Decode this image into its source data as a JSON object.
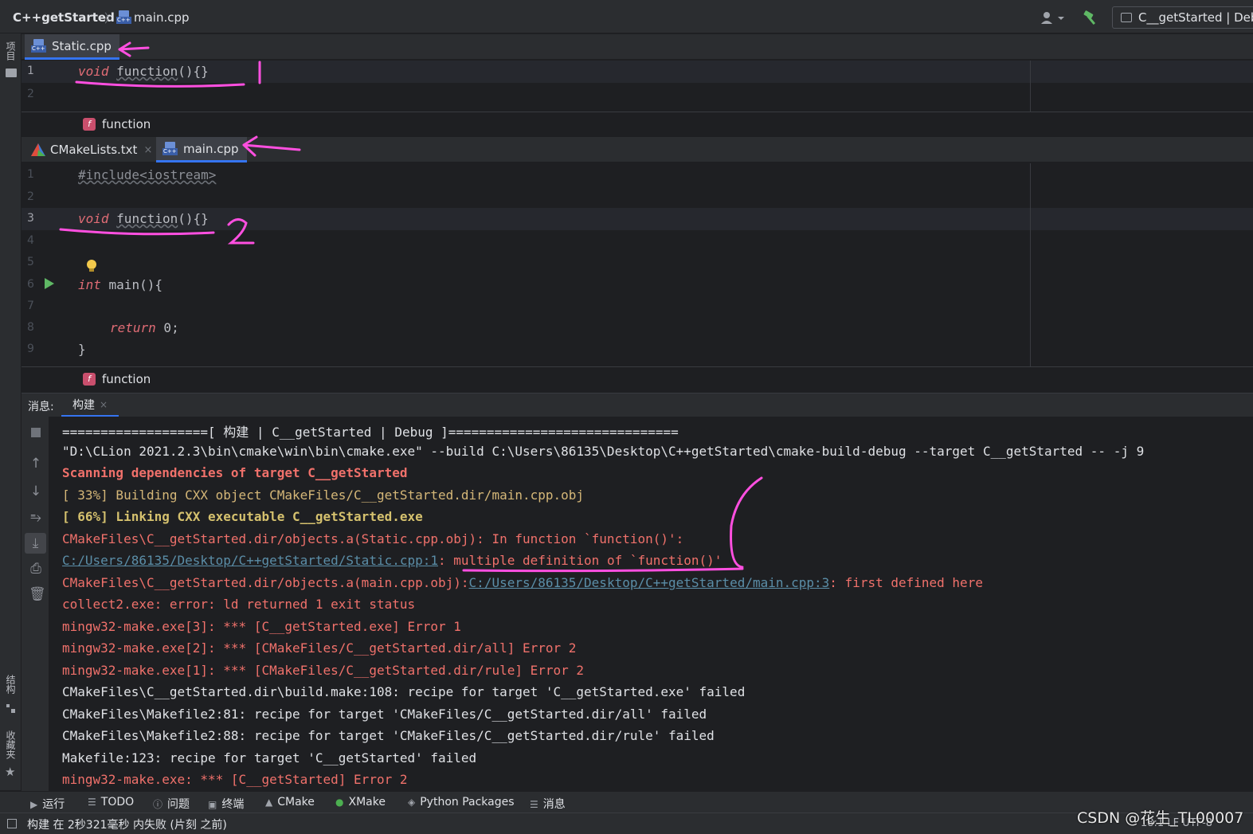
{
  "navbar": {
    "project": "C++getStarted",
    "separator": "〉",
    "file": "main.cpp",
    "run_config": "C__getStarted | Deb"
  },
  "left_strip": {
    "project_label": "项目",
    "structure_label": "结构",
    "favorites_label": "收藏夹"
  },
  "editor_top": {
    "tab": "Static.cpp",
    "lines": [
      "1",
      "2"
    ],
    "code": {
      "kw": "void",
      "fn": "function",
      "rest": "(){}"
    },
    "breadcrumb": "function",
    "annotation_mark": "1"
  },
  "editor_main": {
    "tabs": [
      {
        "label": "CMakeLists.txt",
        "close": "×"
      },
      {
        "label": "main.cpp"
      }
    ],
    "lines": [
      "1",
      "2",
      "3",
      "4",
      "5",
      "6",
      "7",
      "8",
      "9"
    ],
    "code": {
      "include": "#include<iostream>",
      "void_kw": "void",
      "fn_name": "function",
      "fn_rest": "(){}",
      "int_kw": "int",
      "main_decl": " main(){",
      "return_kw": "return",
      "return_rest": " 0;",
      "close": "}"
    },
    "breadcrumb": "function",
    "annotation_mark": "2"
  },
  "messages": {
    "label": "消息:",
    "tab": "构建",
    "tab_close": "×",
    "output": [
      {
        "text": "===================[ 构建 | C__getStarted | Debug ]==============================",
        "style": "w"
      },
      {
        "text": "\"D:\\CLion 2021.2.3\\bin\\cmake\\win\\bin\\cmake.exe\" --build C:\\Users\\86135\\Desktop\\C++getStarted\\cmake-build-debug --target C__getStarted -- -j 9",
        "style": "w"
      },
      {
        "text": "Scanning dependencies of target C__getStarted",
        "style": "rb"
      },
      {
        "text": "[ 33%] Building CXX object CMakeFiles/C__getStarted.dir/main.cpp.obj",
        "style": "y"
      },
      {
        "text": "[ 66%] Linking CXX executable C__getStarted.exe",
        "style": "yb"
      },
      {
        "text": "CMakeFiles\\C__getStarted.dir/objects.a(Static.cpp.obj): In function `function()':",
        "style": "r"
      },
      {
        "link": "C:/Users/86135/Desktop/C++getStarted/Static.cpp:1",
        "sep": ": ",
        "rest": "multiple definition of `function()'"
      },
      {
        "prefix": "CMakeFiles\\C__getStarted.dir/objects.a(main.cpp.obj):",
        "link": "C:/Users/86135/Desktop/C++getStarted/main.cpp:3",
        "rest": ": first defined here"
      },
      {
        "text": "collect2.exe: error: ld returned 1 exit status",
        "style": "r"
      },
      {
        "text": "mingw32-make.exe[3]: *** [C__getStarted.exe] Error 1",
        "style": "r"
      },
      {
        "text": "mingw32-make.exe[2]: *** [CMakeFiles/C__getStarted.dir/all] Error 2",
        "style": "r"
      },
      {
        "text": "mingw32-make.exe[1]: *** [CMakeFiles/C__getStarted.dir/rule] Error 2",
        "style": "r"
      },
      {
        "text": "CMakeFiles\\C__getStarted.dir\\build.make:108: recipe for target 'C__getStarted.exe' failed",
        "style": "w"
      },
      {
        "text": "CMakeFiles\\Makefile2:81: recipe for target 'CMakeFiles/C__getStarted.dir/all' failed",
        "style": "w"
      },
      {
        "text": "CMakeFiles\\Makefile2:88: recipe for target 'CMakeFiles/C__getStarted.dir/rule' failed",
        "style": "w"
      },
      {
        "text": "Makefile:123: recipe for target 'C__getStarted' failed",
        "style": "w"
      },
      {
        "text": "mingw32-make.exe: *** [C__getStarted] Error 2",
        "style": "r"
      }
    ]
  },
  "toolwindows": [
    {
      "icon": "run-icon",
      "label": "运行"
    },
    {
      "icon": "todo-icon",
      "label": "TODO"
    },
    {
      "icon": "problems-icon",
      "label": "问题"
    },
    {
      "icon": "terminal-icon",
      "label": "终端"
    },
    {
      "icon": "cmake-icon",
      "label": "CMake"
    },
    {
      "icon": "xmake-icon",
      "label": "XMake"
    },
    {
      "icon": "python-packages-icon",
      "label": "Python Packages"
    },
    {
      "icon": "messages-icon",
      "label": "消息"
    }
  ],
  "status": {
    "text": "构建 在 2秒321毫秒 内失败 (片刻 之前)",
    "position": "18:1   LF   UTF-8"
  },
  "watermark": "CSDN @花生_TL00007",
  "colors": {
    "accent": "#3574f0",
    "annotation": "#ff4fe0",
    "error_text": "#f0716b",
    "link": "#5b8ea8"
  }
}
